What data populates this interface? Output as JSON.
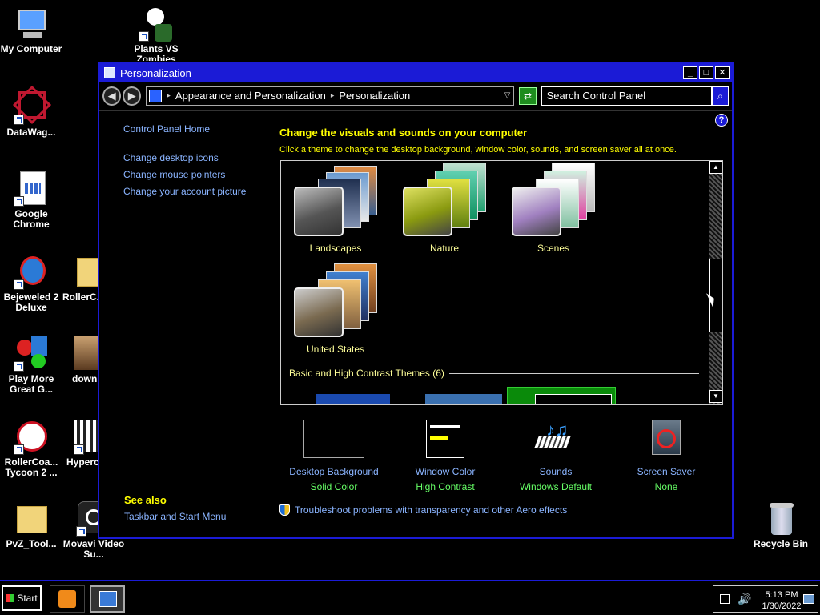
{
  "desktop": {
    "icons": [
      {
        "label": "My Computer"
      },
      {
        "label": "Plants VS Zombies"
      },
      {
        "label": "DataWag..."
      },
      {
        "label": "Google Chrome"
      },
      {
        "label": "Bejeweled 2 Deluxe"
      },
      {
        "label": "RollerC..."
      },
      {
        "label": "Play More Great G..."
      },
      {
        "label": "downl..."
      },
      {
        "label": "RollerCoa... Tycoon 2 ..."
      },
      {
        "label": "Hyperc..."
      },
      {
        "label": "PvZ_Tool..."
      },
      {
        "label": "Movavi Video Su..."
      },
      {
        "label": "Recycle Bin"
      }
    ]
  },
  "window": {
    "title": "Personalization",
    "breadcrumb": [
      "Appearance and Personalization",
      "Personalization"
    ],
    "search_placeholder": "Search Control Panel",
    "help": "?",
    "left_links": {
      "home": "Control Panel Home",
      "items": [
        "Change desktop icons",
        "Change mouse pointers",
        "Change your account picture"
      ]
    },
    "see_also": {
      "heading": "See also",
      "link": "Taskbar and Start Menu"
    },
    "heading": "Change the visuals and sounds on your computer",
    "subheading": "Click a theme to change the desktop background, window color, sounds, and screen saver all at once.",
    "themes": [
      "Landscapes",
      "Nature",
      "Scenes",
      "United States"
    ],
    "basic_header": "Basic and High Contrast Themes (6)",
    "bottom": [
      {
        "name": "Desktop Background",
        "value": "Solid Color"
      },
      {
        "name": "Window Color",
        "value": "High Contrast"
      },
      {
        "name": "Sounds",
        "value": "Windows Default"
      },
      {
        "name": "Screen Saver",
        "value": "None"
      }
    ],
    "troubleshoot": "Troubleshoot problems with transparency and other Aero effects"
  },
  "taskbar": {
    "start": "Start",
    "time": "5:13 PM",
    "date": "1/30/2022"
  },
  "colors": {
    "accent": "#1b1bd6",
    "heading": "#ffff00",
    "link": "#8ab4ff",
    "value": "#66ff66"
  }
}
